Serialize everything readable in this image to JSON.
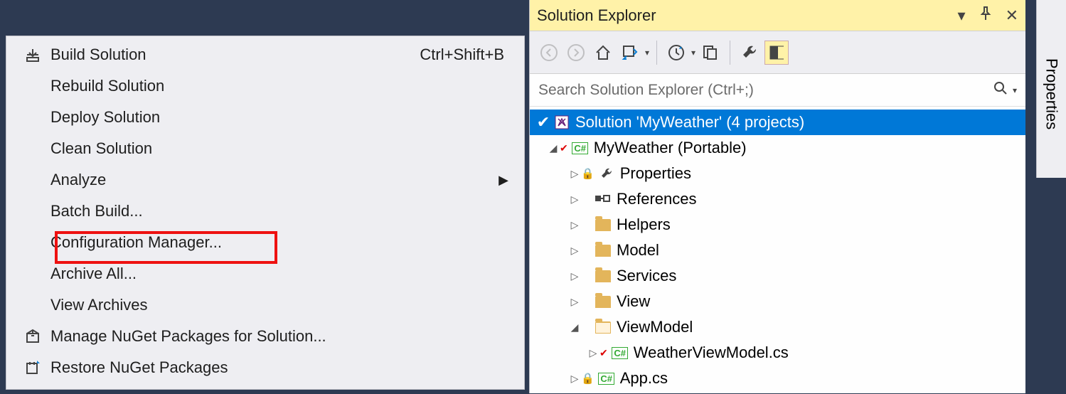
{
  "menu": {
    "items": [
      {
        "icon": "build-icon",
        "label": "Build Solution",
        "shortcut": "Ctrl+Shift+B"
      },
      {
        "label": "Rebuild Solution"
      },
      {
        "label": "Deploy Solution"
      },
      {
        "label": "Clean Solution"
      },
      {
        "label": "Analyze",
        "submenu": true
      },
      {
        "label": "Batch Build..."
      },
      {
        "label": "Configuration Manager...",
        "highlighted": true
      },
      {
        "label": "Archive All..."
      },
      {
        "label": "View Archives"
      },
      {
        "icon": "nuget-icon",
        "label": "Manage NuGet Packages for Solution..."
      },
      {
        "icon": "restore-icon",
        "label": "Restore NuGet Packages"
      }
    ]
  },
  "solutionExplorer": {
    "title": "Solution Explorer",
    "search_placeholder": "Search Solution Explorer (Ctrl+;)",
    "solution_label": "Solution 'MyWeather' (4 projects)",
    "project": "MyWeather (Portable)",
    "nodes": [
      "Properties",
      "References",
      "Helpers",
      "Model",
      "Services",
      "View",
      "ViewModel"
    ],
    "file1": "WeatherViewModel.cs",
    "file2": "App.cs"
  },
  "propertiesTab": "Properties"
}
